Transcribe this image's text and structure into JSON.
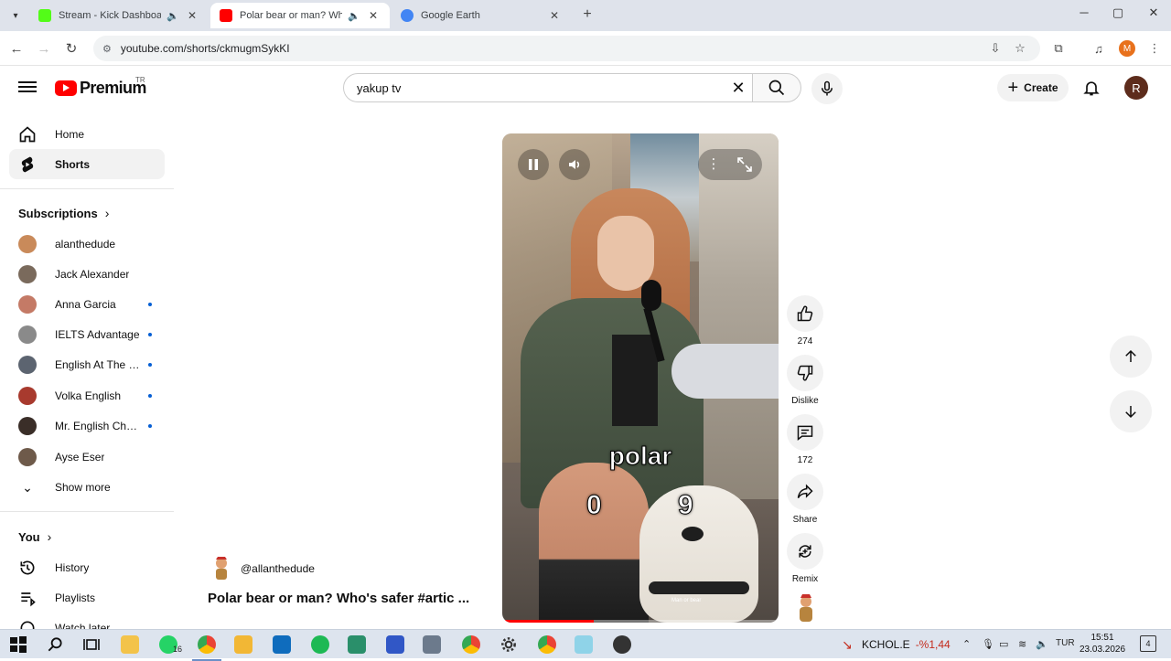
{
  "browser": {
    "tabs": [
      {
        "title": "Stream - Kick Dashboard",
        "favicon_color": "#53fc18"
      },
      {
        "title": "Polar bear or man? Who's safer",
        "favicon_color": "#ff0000"
      },
      {
        "title": "Google Earth",
        "favicon_color": "#4285f4"
      }
    ],
    "url": "youtube.com/shorts/ckmugmSykKI",
    "profile_letter": "M"
  },
  "header": {
    "logo_text": "Premium",
    "country_code": "TR",
    "search_value": "yakup tv",
    "create_label": "Create",
    "avatar_letter": "R"
  },
  "sidebar": {
    "main": [
      {
        "label": "Home"
      },
      {
        "label": "Shorts"
      }
    ],
    "subscriptions_heading": "Subscriptions",
    "subscriptions": [
      {
        "name": "alanthedude",
        "color": "#c98a5a",
        "new": false
      },
      {
        "name": "Jack Alexander",
        "color": "#7a6a5c",
        "new": false
      },
      {
        "name": "Anna Garcia",
        "color": "#c47a66",
        "new": true
      },
      {
        "name": "IELTS Advantage",
        "color": "#8a8a8a",
        "new": true
      },
      {
        "name": "English At The Races",
        "color": "#5c6470",
        "new": true
      },
      {
        "name": "Volka English",
        "color": "#a83a2e",
        "new": true
      },
      {
        "name": "Mr. English Channel",
        "color": "#3a2e28",
        "new": true
      },
      {
        "name": "Ayse Eser",
        "color": "#6e5a4a",
        "new": false
      }
    ],
    "show_more": "Show more",
    "you_heading": "You",
    "you_items": [
      {
        "label": "History"
      },
      {
        "label": "Playlists"
      },
      {
        "label": "Watch later"
      }
    ]
  },
  "short": {
    "caption": "polar",
    "score_left": "0",
    "score_right": "9",
    "collar_text": "Man or bear",
    "channel": "@allanthedude",
    "title": "Polar bear or man? Who's safer #artic ...",
    "progress": 0.33
  },
  "actions": {
    "likes": "274",
    "dislike": "Dislike",
    "comments": "172",
    "share": "Share",
    "remix": "Remix"
  },
  "taskbar": {
    "whatsapp_badge": "16",
    "ticker_name": "KCHOL.E",
    "ticker_change": "-%1,44",
    "language": "TUR",
    "time": "15:51",
    "date": "23.03.2026",
    "notifications": "4"
  }
}
